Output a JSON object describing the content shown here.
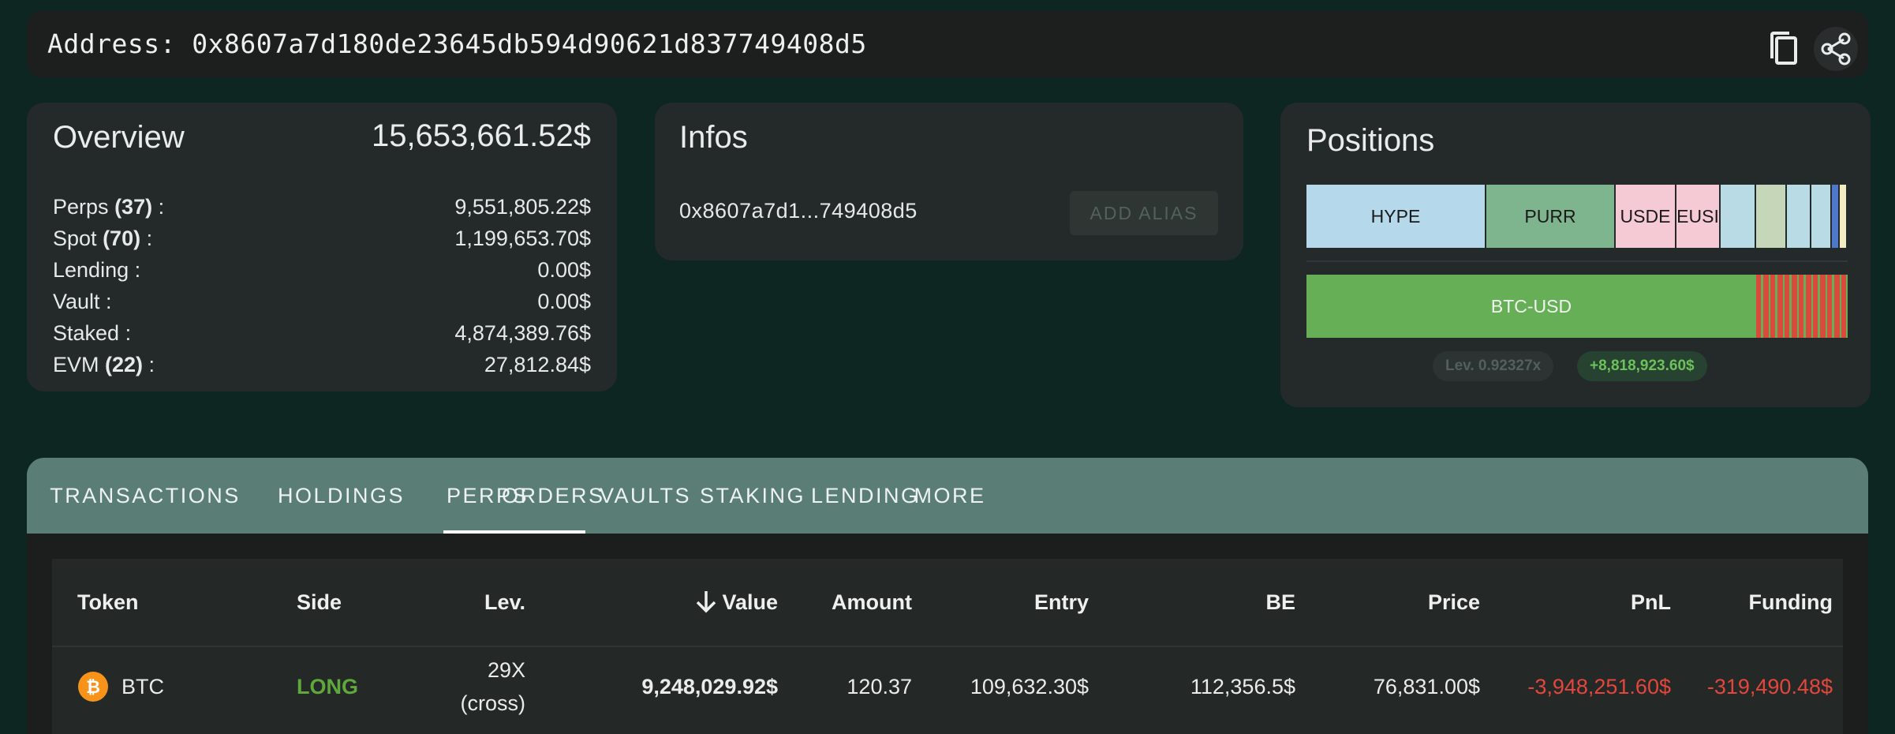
{
  "header": {
    "address_label": "Address: 0x8607a7d180de23645db594d90621d837749408d5"
  },
  "overview": {
    "title": "Overview",
    "total": "15,653,661.52$",
    "rows": [
      {
        "label": "Perps",
        "count": "(37)",
        "suffix": " :",
        "value": "9,551,805.22$"
      },
      {
        "label": "Spot",
        "count": "(70)",
        "suffix": " :",
        "value": "1,199,653.70$"
      },
      {
        "label": "Lending",
        "count": "",
        "suffix": " :",
        "value": "0.00$"
      },
      {
        "label": "Vault",
        "count": "",
        "suffix": " :",
        "value": "0.00$"
      },
      {
        "label": "Staked",
        "count": "",
        "suffix": " :",
        "value": "4,874,389.76$"
      },
      {
        "label": "EVM",
        "count": "(22)",
        "suffix": " :",
        "value": "27,812.84$"
      }
    ]
  },
  "infos": {
    "title": "Infos",
    "short_address": "0x8607a7d1...749408d5",
    "add_alias_label": "ADD ALIAS"
  },
  "positions": {
    "title": "Positions",
    "spot_segments": [
      {
        "label": "HYPE",
        "color": "#b5d8ea"
      },
      {
        "label": "PURR",
        "color": "#7fb58e"
      },
      {
        "label": "USDE",
        "color": "#f6cad5"
      },
      {
        "label": "EUSI",
        "color": "#f6cad5"
      },
      {
        "label": "",
        "color": "#b8dbe6"
      },
      {
        "label": "",
        "color": "#c6d7b9"
      },
      {
        "label": "",
        "color": "#b8dbe6"
      },
      {
        "label": "",
        "color": "#b8dbe6"
      },
      {
        "label": "",
        "color": "#4f79c8"
      },
      {
        "label": "",
        "color": "#f3ebc4"
      }
    ],
    "perp_label": "BTC-USD",
    "leverage_label": "Lev.",
    "leverage_value": "0.92327x",
    "pnl_total": "+8,818,923.60$"
  },
  "tabs": [
    {
      "label": "TRANSACTIONS",
      "active": false
    },
    {
      "label": "HOLDINGS",
      "active": false
    },
    {
      "label": "PERPS",
      "active": true
    },
    {
      "label": "ORDERS",
      "active": false
    },
    {
      "label": "VAULTS",
      "active": false
    },
    {
      "label": "STAKING",
      "active": false
    },
    {
      "label": "LENDING",
      "active": false
    },
    {
      "label": "MORE",
      "active": false
    }
  ],
  "table": {
    "columns": [
      "Token",
      "Side",
      "Lev.",
      "Value",
      "Amount",
      "Entry",
      "BE",
      "Price",
      "PnL",
      "Funding"
    ],
    "sorted_column": "Value",
    "rows": [
      {
        "token": "BTC",
        "side": "LONG",
        "lev_line1": "29X",
        "lev_line2": "(cross)",
        "value": "9,248,029.92$",
        "amount": "120.37",
        "entry": "109,632.30$",
        "be": "112,356.5$",
        "price": "76,831.00$",
        "pnl": "-3,948,251.60$",
        "funding": "-319,490.48$"
      }
    ]
  },
  "colors": {
    "long": "#5fa83c",
    "negative": "#e5463b",
    "btc_orange": "#f7931a"
  }
}
